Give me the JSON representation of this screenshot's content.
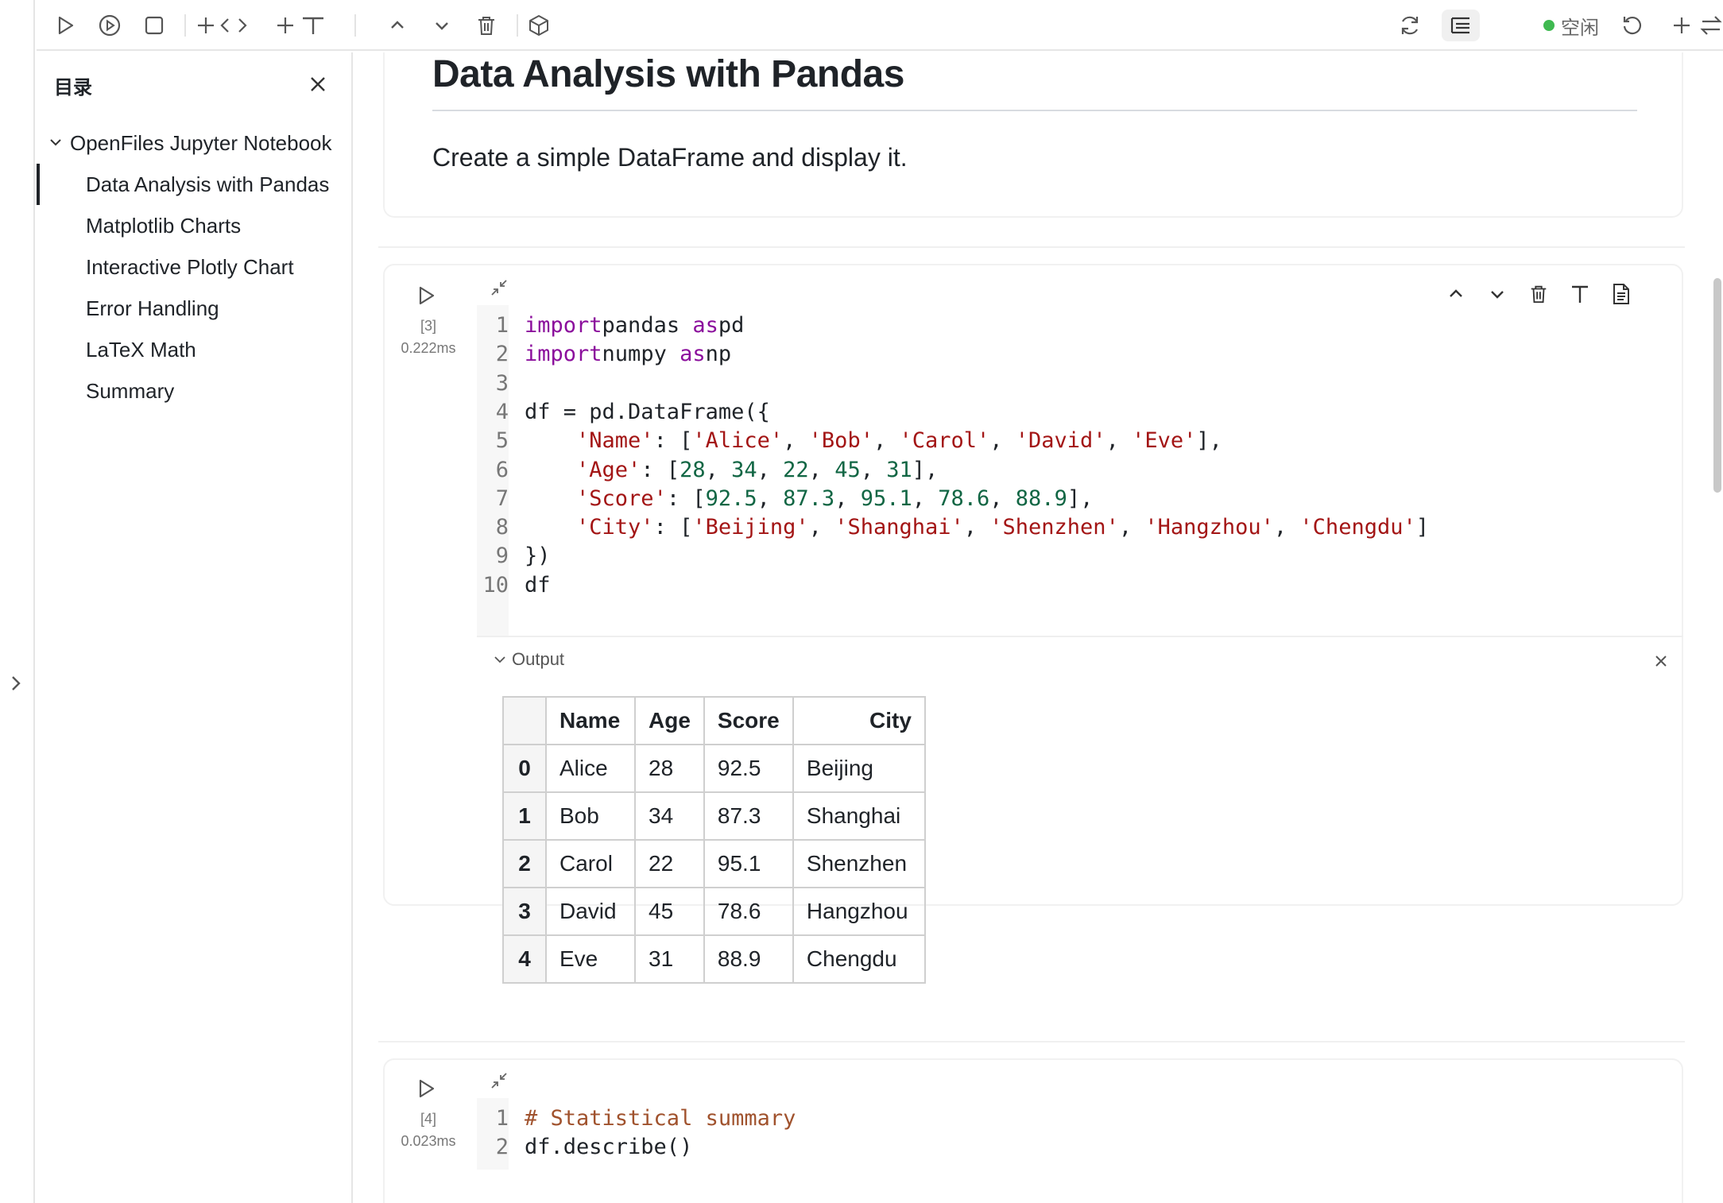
{
  "toolbar": {
    "left_icons": [
      "run-icon",
      "run-all-icon",
      "stop-icon",
      "add-code-icon",
      "code-icon",
      "add-text-icon",
      "text-icon",
      "move-up-icon",
      "move-down-icon",
      "delete-icon",
      "package-icon"
    ],
    "kernel_status": "空闲",
    "status_color": "#3fb950",
    "right_icons": [
      "refresh-icon",
      "toc-icon",
      "restart-icon",
      "add-icon",
      "switch-icon"
    ]
  },
  "sidebar": {
    "title": "目录",
    "root": "OpenFiles Jupyter Notebook",
    "items": [
      {
        "label": "Data Analysis with Pandas",
        "active": true
      },
      {
        "label": "Matplotlib Charts"
      },
      {
        "label": "Interactive Plotly Chart"
      },
      {
        "label": "Error Handling"
      },
      {
        "label": "LaTeX Math"
      },
      {
        "label": "Summary"
      }
    ]
  },
  "markdown_cell": {
    "heading": "Data Analysis with Pandas",
    "paragraph": "Create a simple DataFrame and display it."
  },
  "cells": [
    {
      "exec_count": "[3]",
      "exec_time": "0.222ms",
      "lines": [
        [
          [
            "kw",
            "import"
          ],
          [
            "",
            "pandas "
          ],
          [
            "kw",
            "as"
          ],
          [
            "",
            "pd"
          ]
        ],
        [
          [
            "kw",
            "import"
          ],
          [
            "",
            "numpy "
          ],
          [
            "kw",
            "as"
          ],
          [
            "",
            "np"
          ]
        ],
        [],
        [
          [
            "",
            "df = pd.DataFrame({"
          ]
        ],
        [
          [
            "",
            "    "
          ],
          [
            "st",
            "'Name'"
          ],
          [
            "",
            ": ["
          ],
          [
            "st",
            "'Alice'"
          ],
          [
            "",
            ", "
          ],
          [
            "st",
            "'Bob'"
          ],
          [
            "",
            ", "
          ],
          [
            "st",
            "'Carol'"
          ],
          [
            "",
            ", "
          ],
          [
            "st",
            "'David'"
          ],
          [
            "",
            ", "
          ],
          [
            "st",
            "'Eve'"
          ],
          [
            "",
            "],"
          ]
        ],
        [
          [
            "",
            "    "
          ],
          [
            "st",
            "'Age'"
          ],
          [
            "",
            ": ["
          ],
          [
            "nm",
            "28"
          ],
          [
            "",
            ", "
          ],
          [
            "nm",
            "34"
          ],
          [
            "",
            ", "
          ],
          [
            "nm",
            "22"
          ],
          [
            "",
            ", "
          ],
          [
            "nm",
            "45"
          ],
          [
            "",
            ", "
          ],
          [
            "nm",
            "31"
          ],
          [
            "",
            "],"
          ]
        ],
        [
          [
            "",
            "    "
          ],
          [
            "st",
            "'Score'"
          ],
          [
            "",
            ": ["
          ],
          [
            "nm",
            "92.5"
          ],
          [
            "",
            ", "
          ],
          [
            "nm",
            "87.3"
          ],
          [
            "",
            ", "
          ],
          [
            "nm",
            "95.1"
          ],
          [
            "",
            ", "
          ],
          [
            "nm",
            "78.6"
          ],
          [
            "",
            ", "
          ],
          [
            "nm",
            "88.9"
          ],
          [
            "",
            "],"
          ]
        ],
        [
          [
            "",
            "    "
          ],
          [
            "st",
            "'City'"
          ],
          [
            "",
            ": ["
          ],
          [
            "st",
            "'Beijing'"
          ],
          [
            "",
            ", "
          ],
          [
            "st",
            "'Shanghai'"
          ],
          [
            "",
            ", "
          ],
          [
            "st",
            "'Shenzhen'"
          ],
          [
            "",
            ", "
          ],
          [
            "st",
            "'Hangzhou'"
          ],
          [
            "",
            ", "
          ],
          [
            "st",
            "'Chengdu'"
          ],
          [
            "",
            "]"
          ]
        ],
        [
          [
            "",
            "})"
          ]
        ],
        [
          [
            "",
            "df"
          ]
        ]
      ],
      "output_label": "Output",
      "table": {
        "columns": [
          "",
          "Name",
          "Age",
          "Score",
          "City"
        ],
        "rows": [
          [
            "0",
            "Alice",
            "28",
            "92.5",
            "Beijing"
          ],
          [
            "1",
            "Bob",
            "34",
            "87.3",
            "Shanghai"
          ],
          [
            "2",
            "Carol",
            "22",
            "95.1",
            "Shenzhen"
          ],
          [
            "3",
            "David",
            "45",
            "78.6",
            "Hangzhou"
          ],
          [
            "4",
            "Eve",
            "31",
            "88.9",
            "Chengdu"
          ]
        ]
      }
    },
    {
      "exec_count": "[4]",
      "exec_time": "0.023ms",
      "lines": [
        [
          [
            "cm",
            "# Statistical summary"
          ]
        ],
        [
          [
            "",
            "df.describe()"
          ]
        ]
      ]
    }
  ]
}
